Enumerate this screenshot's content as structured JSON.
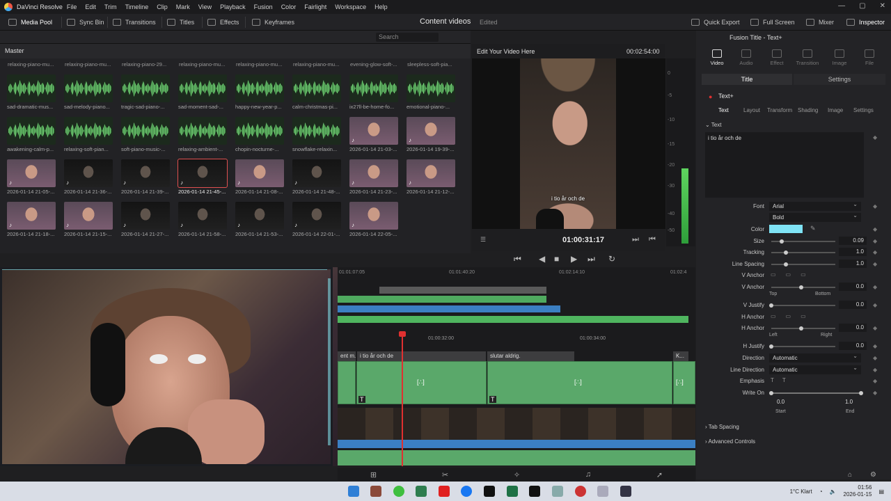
{
  "app": {
    "name": "DaVinci Resolve",
    "menu": [
      "File",
      "Edit",
      "Trim",
      "Timeline",
      "Clip",
      "Mark",
      "View",
      "Playback",
      "Fusion",
      "Color",
      "Fairlight",
      "Workspace",
      "Help"
    ]
  },
  "toolbar": {
    "media_pool": "Media Pool",
    "sync_bin": "Sync Bin",
    "transitions": "Transitions",
    "titles": "Titles",
    "effects": "Effects",
    "keyframes": "Keyframes",
    "project_title": "Content videos",
    "edited": "Edited",
    "quick_export": "Quick Export",
    "full_screen": "Full Screen",
    "mixer": "Mixer",
    "inspector": "Inspector"
  },
  "mediapool": {
    "search_placeholder": "Search",
    "master": "Master",
    "top_labels": [
      "relaxing-piano-mu...",
      "relaxing-piano-mu...",
      "relaxing-piano-29...",
      "relaxing-piano-mu...",
      "relaxing-piano-mu...",
      "relaxing-piano-mu...",
      "evening-glow-soft-...",
      "sleepless-soft-pia..."
    ],
    "row1": [
      "sad-dramatic-mus...",
      "sad-melody-piano...",
      "tragic-sad-piano-...",
      "sad-moment-sad-...",
      "happy-new-year-p...",
      "calm-christmas-pi...",
      "ix27ll-be-home-fo...",
      "emotional-piano-..."
    ],
    "row2": [
      "awakening-calm-p...",
      "relaxing-soft-pian...",
      "soft-piano-music-...",
      "relaxing-ambient-...",
      "chopin-nocturne-...",
      "snowflake-relaxin...",
      "2026-01-14 21-03-...",
      "2026-01-14 19-39-..."
    ],
    "row3": [
      "2026-01-14 21-05-...",
      "2026-01-14 21-36-...",
      "2026-01-14 21-39-...",
      "2026-01-14 21-45-...",
      "2026-01-14 21-08-...",
      "2026-01-14 21-48-...",
      "2026-01-14 21-23-...",
      "2026-01-14 21-12-..."
    ],
    "row4": [
      "2026-01-14 21-18-...",
      "2026-01-14 21-15-...",
      "2026-01-14 21-27-...",
      "2026-01-14 21-58-...",
      "2026-01-14 21-53-...",
      "2026-01-14 22-01-...",
      "2026-01-14 22-05-..."
    ]
  },
  "viewer": {
    "timeline_name": "Edit Your Video Here",
    "duration": "00:02:54:00",
    "subtitle": "i tio år och de",
    "timecode": "01:00:31:17"
  },
  "meter": {
    "labels": [
      "0",
      "-5",
      "-10",
      "-15",
      "-20",
      "-30",
      "-40",
      "-50"
    ],
    "level": 0.42
  },
  "timeline": {
    "ruler_top": [
      "01:01:07:05",
      "01:01:40:20",
      "01:02:14:10",
      "01:02:4"
    ],
    "ruler": [
      "01:00:32:00",
      "01:00:34:00"
    ],
    "titles": [
      "ent m...",
      "i tio år och de",
      "slutar aldrig.",
      "K..."
    ]
  },
  "inspector": {
    "header": "Fusion Title - Text+",
    "tabs": [
      "Video",
      "Audio",
      "Effect",
      "Transition",
      "Image",
      "File"
    ],
    "seg_title": "Title",
    "seg_settings": "Settings",
    "node": "Text+",
    "subtabs": [
      "Text",
      "Layout",
      "Transform",
      "Shading",
      "Image",
      "Settings"
    ],
    "section_text": "Text",
    "text_value": "i tio år och de",
    "props": {
      "font_label": "Font",
      "font": "Arial",
      "style": "Bold",
      "color_label": "Color",
      "color": "#7fe3f5",
      "size_label": "Size",
      "size": "0.09",
      "tracking_label": "Tracking",
      "tracking": "1.0",
      "line_spacing_label": "Line Spacing",
      "line_spacing": "1.0",
      "v_anchor_label": "V Anchor",
      "v_anchor2_label": "V Anchor",
      "v_anchor_val": "0.0",
      "top": "Top",
      "bottom": "Bottom",
      "v_justify_label": "V Justify",
      "v_justify": "0.0",
      "h_anchor_label": "H Anchor",
      "h_anchor2_label": "H Anchor",
      "h_anchor_val": "0.0",
      "left": "Left",
      "right": "Right",
      "h_justify_label": "H Justify",
      "h_justify": "0.0",
      "direction_label": "Direction",
      "direction": "Automatic",
      "line_direction_label": "Line Direction",
      "line_direction": "Automatic",
      "emphasis_label": "Emphasis",
      "write_on_label": "Write On",
      "start_val": "0.0",
      "end_val": "1.0",
      "start": "Start",
      "end": "End"
    },
    "tab_spacing": "Tab Spacing",
    "advanced": "Advanced Controls"
  },
  "taskbar": {
    "weather": "1°C  Klart",
    "time": "01:56",
    "date": "2026-01-15"
  }
}
